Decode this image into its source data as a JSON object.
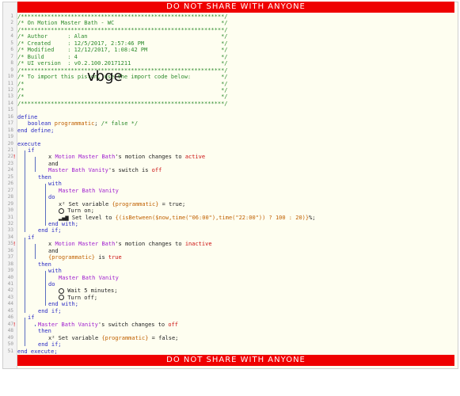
{
  "banner": "DO NOT SHARE WITH ANYONE",
  "watermark": "vbge",
  "lines": [
    {
      "n": "1",
      "text": "/*************************************************************/",
      "cls": "c",
      "indent": 0
    },
    {
      "n": "2",
      "text": "/* On Motion Master Bath - WC                                */",
      "cls": "c",
      "indent": 0
    },
    {
      "n": "3",
      "text": "/*************************************************************/",
      "cls": "c",
      "indent": 0
    },
    {
      "n": "4",
      "text": "/* Author      : Alan                                        */",
      "cls": "c",
      "indent": 0
    },
    {
      "n": "5",
      "text": "/* Created     : 12/5/2017, 2:57:46 PM                       */",
      "cls": "c",
      "indent": 0
    },
    {
      "n": "6",
      "text": "/* Modified    : 12/12/2017, 1:08:42 PM                      */",
      "cls": "c",
      "indent": 0
    },
    {
      "n": "7",
      "text": "/* Build       : 4                                           */",
      "cls": "c",
      "indent": 0
    },
    {
      "n": "8",
      "text": "/* UI version  : v0.2.100.20171211                           */",
      "cls": "c",
      "indent": 0
    },
    {
      "n": "9",
      "text": "/*************************************************************/",
      "cls": "c",
      "indent": 0
    },
    {
      "n": "10",
      "text": "/* To import this piston, use the import code below:         */",
      "cls": "c",
      "indent": 0
    },
    {
      "n": "11",
      "text": "/*                                                           */",
      "cls": "c",
      "indent": 0
    },
    {
      "n": "12",
      "text": "/*                                                           */",
      "cls": "c",
      "indent": 0
    },
    {
      "n": "13",
      "text": "/*                                                           */",
      "cls": "c",
      "indent": 0
    },
    {
      "n": "14",
      "text": "/*************************************************************/",
      "cls": "c",
      "indent": 0
    },
    {
      "n": "15",
      "text": "",
      "cls": "t",
      "indent": 0
    },
    {
      "n": "16",
      "text": "define",
      "cls": "k",
      "indent": 0
    },
    {
      "n": "17",
      "text": "boolean programmatic; /* false */",
      "cls": "mix17",
      "indent": 1
    },
    {
      "n": "18",
      "text": "end define;",
      "cls": "k",
      "indent": 0
    },
    {
      "n": "19",
      "text": "",
      "cls": "t",
      "indent": 0
    },
    {
      "n": "20",
      "text": "execute",
      "cls": "k",
      "indent": 0
    },
    {
      "n": "21",
      "text": "if",
      "cls": "k",
      "indent": 1
    },
    {
      "n": "22",
      "text": "Motion Master Bath's motion changes to active",
      "cls": "mix22",
      "indent": 3,
      "warn": true
    },
    {
      "n": "23",
      "text": "and",
      "cls": "t",
      "indent": 3
    },
    {
      "n": "24",
      "text": "Master Bath Vanity's switch is off",
      "cls": "mix24",
      "indent": 3
    },
    {
      "n": "25",
      "text": "then",
      "cls": "k",
      "indent": 2
    },
    {
      "n": "26",
      "text": "with",
      "cls": "k",
      "indent": 3
    },
    {
      "n": "27",
      "text": "Master Bath Vanity",
      "cls": "s",
      "indent": 4
    },
    {
      "n": "28",
      "text": "do",
      "cls": "k",
      "indent": 3
    },
    {
      "n": "29",
      "text": "Set variable {programmatic} = true;",
      "cls": "mix29",
      "indent": 4
    },
    {
      "n": "30",
      "text": "Turn on;",
      "cls": "mix30",
      "indent": 4
    },
    {
      "n": "31",
      "text": "Set level to {(isBetween($now,time(\"06:00\"),time(\"22:00\")) ? 100 : 20)}%;",
      "cls": "mix31",
      "indent": 4
    },
    {
      "n": "32",
      "text": "end with;",
      "cls": "k",
      "indent": 3
    },
    {
      "n": "33",
      "text": "end if;",
      "cls": "k",
      "indent": 2
    },
    {
      "n": "34",
      "text": "if",
      "cls": "k",
      "indent": 1
    },
    {
      "n": "35",
      "text": "Motion Master Bath's motion changes to inactive",
      "cls": "mix35",
      "indent": 3,
      "warn": true
    },
    {
      "n": "36",
      "text": "and",
      "cls": "t",
      "indent": 3
    },
    {
      "n": "37",
      "text": "{programmatic} is true",
      "cls": "mix37",
      "indent": 3
    },
    {
      "n": "38",
      "text": "then",
      "cls": "k",
      "indent": 2
    },
    {
      "n": "39",
      "text": "with",
      "cls": "k",
      "indent": 3
    },
    {
      "n": "40",
      "text": "Master Bath Vanity",
      "cls": "s",
      "indent": 4
    },
    {
      "n": "41",
      "text": "do",
      "cls": "k",
      "indent": 3
    },
    {
      "n": "42",
      "text": "Wait 5 minutes;",
      "cls": "mix42",
      "indent": 4
    },
    {
      "n": "43",
      "text": "Turn off;",
      "cls": "mix43",
      "indent": 4
    },
    {
      "n": "44",
      "text": "end with;",
      "cls": "k",
      "indent": 3
    },
    {
      "n": "45",
      "text": "end if;",
      "cls": "k",
      "indent": 2
    },
    {
      "n": "46",
      "text": "if",
      "cls": "k",
      "indent": 1
    },
    {
      "n": "47",
      "text": "Master Bath Vanity's switch changes to off",
      "cls": "mix47",
      "indent": 2,
      "warn": true
    },
    {
      "n": "48",
      "text": "then",
      "cls": "k",
      "indent": 2
    },
    {
      "n": "49",
      "text": "Set variable {programmatic} = false;",
      "cls": "mix49",
      "indent": 3
    },
    {
      "n": "50",
      "text": "end if;",
      "cls": "k",
      "indent": 2
    },
    {
      "n": "51",
      "text": "end execute;",
      "cls": "k",
      "indent": 0
    }
  ]
}
